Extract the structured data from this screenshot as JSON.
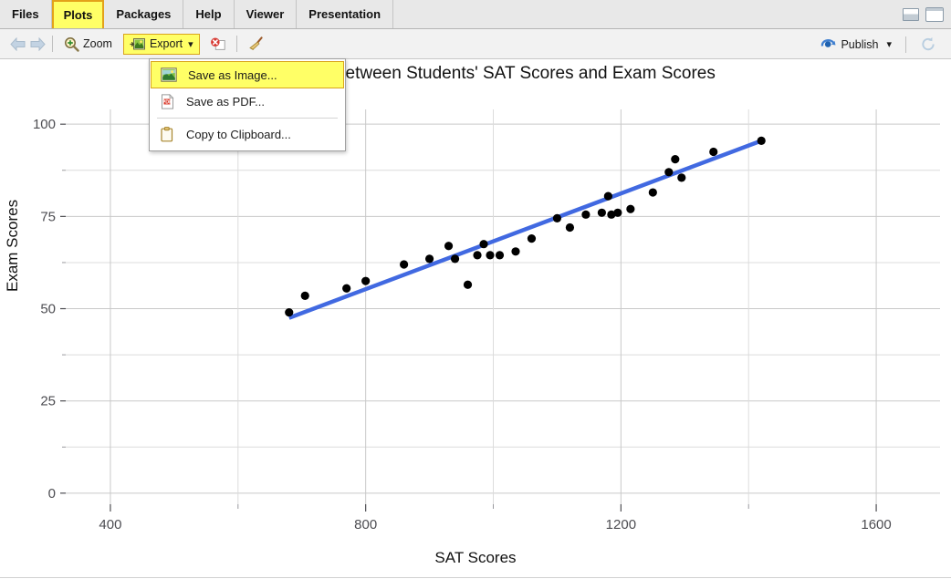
{
  "window": {
    "minimize_label": "minimize",
    "maximize_label": "maximize"
  },
  "tabs": [
    {
      "label": "Files",
      "active": false
    },
    {
      "label": "Plots",
      "active": true
    },
    {
      "label": "Packages",
      "active": false
    },
    {
      "label": "Help",
      "active": false
    },
    {
      "label": "Viewer",
      "active": false
    },
    {
      "label": "Presentation",
      "active": false
    }
  ],
  "toolbar": {
    "back_label": "Back",
    "forward_label": "Forward",
    "zoom_label": "Zoom",
    "export_label": "Export",
    "export_caret": "▾",
    "remove_label": "Remove current plot",
    "clear_label": "Clear all plots",
    "publish_label": "Publish",
    "publish_caret": "▾",
    "refresh_label": "Refresh current plot"
  },
  "export_menu": {
    "items": [
      {
        "label": "Save as Image...",
        "icon": "image-icon",
        "selected": true
      },
      {
        "label": "Save as PDF...",
        "icon": "pdf-icon",
        "selected": false
      },
      {
        "label": "Copy to Clipboard...",
        "icon": "clipboard-icon",
        "selected": false
      }
    ]
  },
  "chart_data": {
    "type": "scatter",
    "title": "Relationship between Students' SAT Scores and Exam Scores",
    "xlabel": "SAT Scores",
    "ylabel": "Exam Scores",
    "xlim": [
      330,
      1700
    ],
    "ylim": [
      -3,
      104
    ],
    "x_ticks": [
      400,
      800,
      1200,
      1600
    ],
    "x_minor_ticks": [
      600,
      1000,
      1400
    ],
    "y_ticks": [
      0,
      25,
      50,
      75,
      100
    ],
    "y_minor_ticks": [
      12.5,
      37.5,
      62.5,
      87.5
    ],
    "grid": true,
    "legend": "none",
    "point_color": "#000000",
    "line_color": "#4169E1",
    "points": [
      {
        "x": 680,
        "y": 49.0
      },
      {
        "x": 705,
        "y": 53.5
      },
      {
        "x": 770,
        "y": 55.5
      },
      {
        "x": 800,
        "y": 57.5
      },
      {
        "x": 860,
        "y": 62.0
      },
      {
        "x": 900,
        "y": 63.5
      },
      {
        "x": 930,
        "y": 67.0
      },
      {
        "x": 940,
        "y": 63.5
      },
      {
        "x": 960,
        "y": 56.5
      },
      {
        "x": 975,
        "y": 64.5
      },
      {
        "x": 985,
        "y": 67.5
      },
      {
        "x": 995,
        "y": 64.5
      },
      {
        "x": 1010,
        "y": 64.5
      },
      {
        "x": 1035,
        "y": 65.5
      },
      {
        "x": 1060,
        "y": 69.0
      },
      {
        "x": 1100,
        "y": 74.5
      },
      {
        "x": 1120,
        "y": 72.0
      },
      {
        "x": 1145,
        "y": 75.5
      },
      {
        "x": 1170,
        "y": 76.0
      },
      {
        "x": 1180,
        "y": 80.5
      },
      {
        "x": 1185,
        "y": 75.5
      },
      {
        "x": 1195,
        "y": 76.0
      },
      {
        "x": 1215,
        "y": 77.0
      },
      {
        "x": 1250,
        "y": 81.5
      },
      {
        "x": 1275,
        "y": 87.0
      },
      {
        "x": 1285,
        "y": 90.5
      },
      {
        "x": 1295,
        "y": 85.5
      },
      {
        "x": 1345,
        "y": 92.5
      },
      {
        "x": 1420,
        "y": 95.5
      }
    ],
    "regression_line": {
      "x_start": 680,
      "y_start": 47.5,
      "x_end": 1420,
      "y_end": 95.5
    }
  }
}
